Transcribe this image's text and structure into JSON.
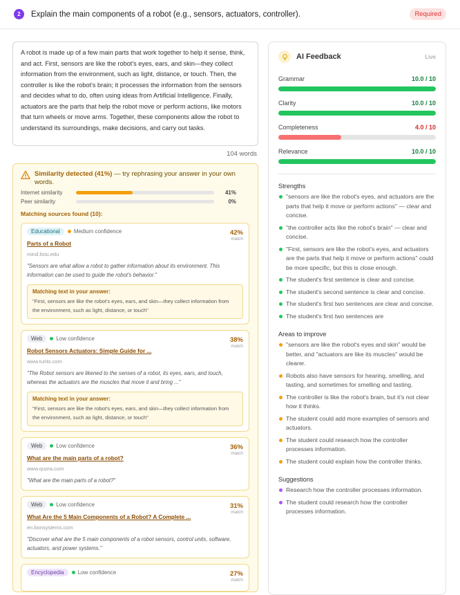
{
  "question": {
    "number": "2",
    "text": "Explain the main components of a robot (e.g., sensors, actuators, controller).",
    "required_label": "Required"
  },
  "answer": {
    "text": "A robot is made up of a few main parts that work together to help it sense, think, and act. First, sensors are like the robot's eyes, ears, and skin—they collect information from the environment, such as light, distance, or touch. Then, the controller is like the robot's brain; it processes the information from the sensors and decides what to do, often using ideas from Artificial Intelligence. Finally, actuators are the parts that help the robot move or perform actions, like motors that turn wheels or move arms. Together, these components allow the robot to understand its surroundings, make decisions, and carry out tasks.",
    "word_count": "104 words"
  },
  "similarity": {
    "title_bold": "Similarity detected (41%)",
    "title_rest": " — try rephrasing your answer in your own words.",
    "internet_label": "Internet similarity",
    "internet_pct": "41%",
    "internet_value": 41,
    "peer_label": "Peer similarity",
    "peer_pct": "0%",
    "peer_value": 0,
    "matching_header": "Matching sources found (10):",
    "matching_text_label": "Matching text in your answer:",
    "match_label": "match",
    "sources": [
      {
        "type": "Educational",
        "confidence": "Medium confidence",
        "pct": "42%",
        "title": "Parts of a Robot",
        "domain": "mind.listu.edu",
        "quote": "\"Sensors are what allow a robot to gather information about its environment. This information can be used to guide the robot's behavior.\"",
        "matching_text": "\"First, sensors are like the robot's eyes, ears, and skin—they collect information from the environment, such as light, distance, or touch\""
      },
      {
        "type": "Web",
        "confidence": "Low confidence",
        "pct": "38%",
        "title": "Robot Sensors Actuators: Simple Guide for ...",
        "domain": "www.turito.com",
        "quote": "\"The Robot sensors are likened to the senses of a robot, its eyes, ears, and touch, whereas the actuators are the muscles that move it and bring ...\"",
        "matching_text": "\"First, sensors are like the robot's eyes, ears, and skin—they collect information from the environment, such as light, distance, or touch\""
      },
      {
        "type": "Web",
        "confidence": "Low confidence",
        "pct": "36%",
        "title": "What are the main parts of a robot?",
        "domain": "www.quora.com",
        "quote": "\"What are the main parts of a robot?\""
      },
      {
        "type": "Web",
        "confidence": "Low confidence",
        "pct": "31%",
        "title": "What Are the 5 Main Components of a Robot? A Complete ...",
        "domain": "en.bonsystems.com",
        "quote": "\"Discover what are the 5 main components of a robot sensors, control units, software, actuators, and power systems.\""
      },
      {
        "type": "Encyclopedia",
        "confidence": "Low confidence",
        "pct": "27%"
      }
    ]
  },
  "feedback": {
    "title": "AI Feedback",
    "live": "Live",
    "metrics": [
      {
        "label": "Grammar",
        "value": "10.0 / 10",
        "score": 10.0,
        "color": "#22c55e",
        "text_color": "#15803d"
      },
      {
        "label": "Clarity",
        "value": "10.0 / 10",
        "score": 10.0,
        "color": "#22c55e",
        "text_color": "#15803d"
      },
      {
        "label": "Completeness",
        "value": "4.0 / 10",
        "score": 4.0,
        "color": "#f87171",
        "text_color": "#dc2626"
      },
      {
        "label": "Relevance",
        "value": "10.0 / 10",
        "score": 10.0,
        "color": "#22c55e",
        "text_color": "#15803d"
      }
    ],
    "strengths_title": "Strengths",
    "strengths": [
      "\"sensors are like the robot's eyes, and actuators are the parts that help it move or perform actions\" — clear and concise.",
      "\"the controller acts like the robot's brain\" — clear and concise.",
      "\"First, sensors are like the robot's eyes, and actuators are the parts that help it move or perform actions\" could be more specific, but this is close enough.",
      "The student's first sentence is clear and concise.",
      "The student's second sentence is clear and concise.",
      "The student's first two sentences are clear and concise.",
      "The student's first two sentences are"
    ],
    "improve_title": "Areas to improve",
    "improve": [
      "\"sensors are like the robot's eyes and skin\" would be better, and \"actuators are like its muscles\" would be clearer.",
      "Robots also have sensors for hearing, smelling, and tasting, and sometimes for smelling and tasting.",
      "The controller is like the robot's brain, but it's not clear how it thinks.",
      "The student could add more examples of sensors and actuators.",
      "The student could research how the controller processes information.",
      "The student could explain how the controller thinks."
    ],
    "suggestions_title": "Suggestions",
    "suggestions": [
      "Research how the controller processes information.",
      "The student could research how the controller processes information."
    ]
  },
  "colors": {
    "accent": "#7c3aed",
    "strength_dot": "#22c55e",
    "improve_dot": "#f59e0b",
    "suggestion_dot": "#a855f7",
    "medium_conf": "#f59e0b",
    "low_conf": "#22c55e"
  }
}
